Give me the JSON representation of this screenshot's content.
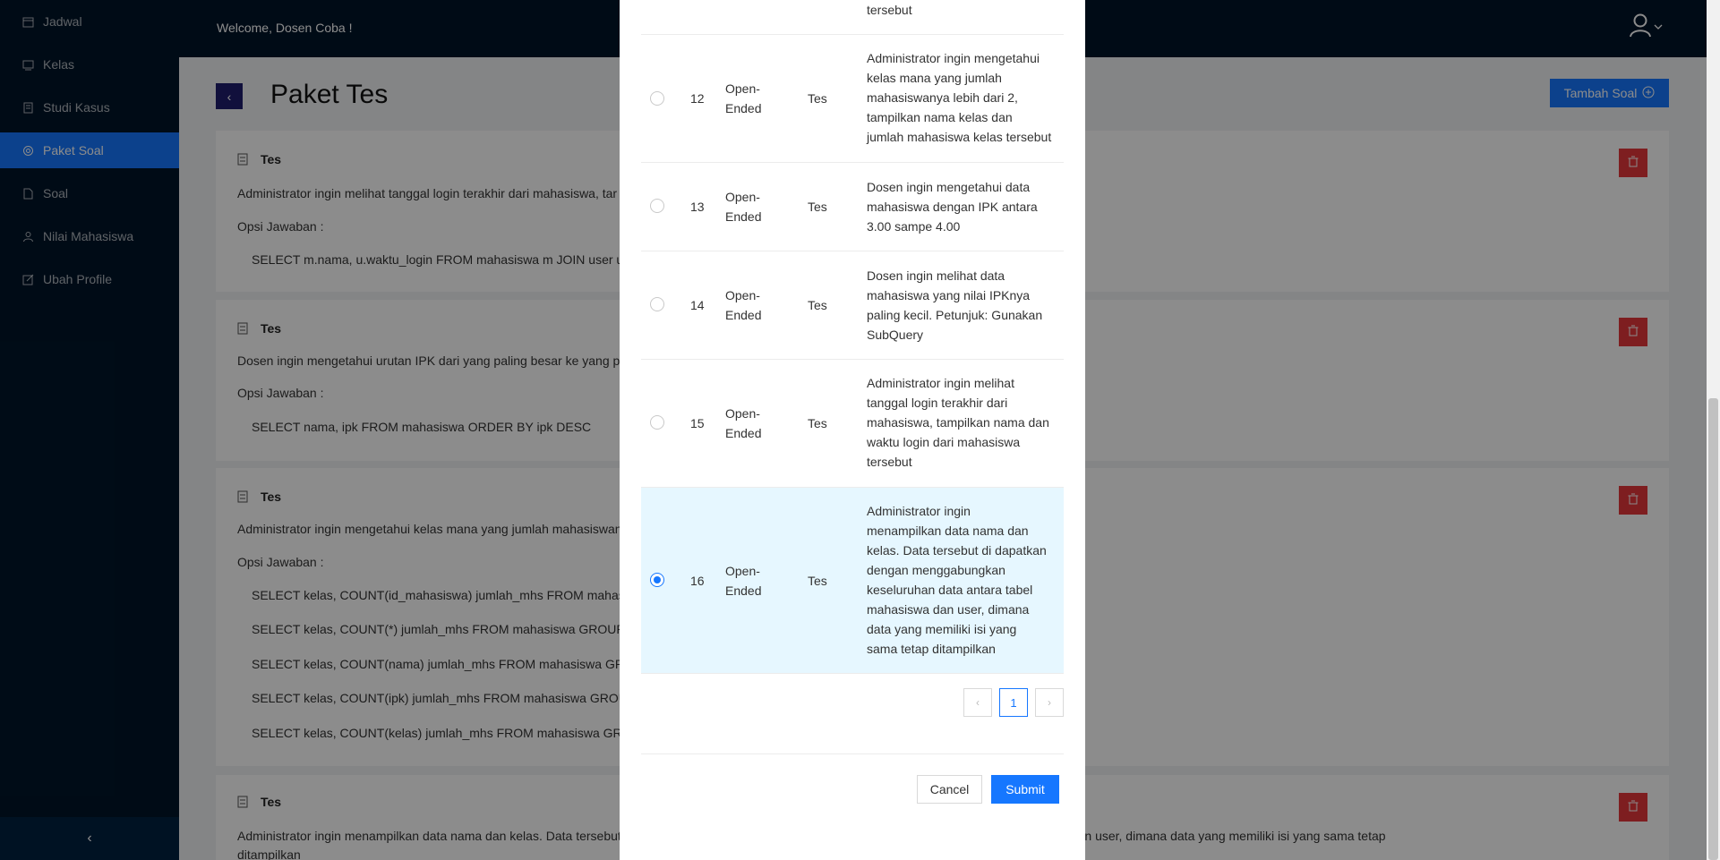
{
  "sidebar": {
    "items": [
      {
        "label": "Jadwal",
        "icon": "calendar-icon"
      },
      {
        "label": "Kelas",
        "icon": "classroom-icon"
      },
      {
        "label": "Studi Kasus",
        "icon": "list-icon"
      },
      {
        "label": "Paket Soal",
        "icon": "package-icon"
      },
      {
        "label": "Soal",
        "icon": "file-icon"
      },
      {
        "label": "Nilai Mahasiswa",
        "icon": "user-icon"
      },
      {
        "label": "Ubah Profile",
        "icon": "edit-icon"
      }
    ],
    "active": "Paket Soal",
    "collapse": "‹"
  },
  "header": {
    "welcome": "Welcome, Dosen Coba !",
    "user_icon": "user-icon",
    "chevron": "⌄"
  },
  "page": {
    "title": "Paket Tes",
    "add_button": "Tambah Soal",
    "back": "‹"
  },
  "cards": [
    {
      "title": "Tes",
      "question": "Administrator ingin melihat tanggal login terakhir dari mahasiswa, tar",
      "options_label": "Opsi Jawaban :",
      "options": [
        "SELECT m.nama, u.waktu_login FROM mahasiswa m JOIN user u ON"
      ]
    },
    {
      "title": "Tes",
      "question": "Dosen ingin mengetahui urutan IPK dari yang paling besar ke yang pa",
      "options_label": "Opsi Jawaban :",
      "options": [
        "SELECT nama, ipk FROM mahasiswa ORDER BY ipk DESC"
      ]
    },
    {
      "title": "Tes",
      "question": "Administrator ingin mengetahui kelas mana yang jumlah mahasiswan",
      "options_label": "Opsi Jawaban :",
      "options": [
        "SELECT kelas, COUNT(id_mahasiswa) jumlah_mhs FROM mahasiswa",
        "SELECT kelas, COUNT(*) jumlah_mhs FROM mahasiswa GROUP BY k",
        "SELECT kelas, COUNT(nama) jumlah_mhs FROM mahasiswa GROUP",
        "SELECT kelas, COUNT(ipk) jumlah_mhs FROM mahasiswa GROUP B",
        "SELECT kelas, COUNT(kelas) jumlah_mhs FROM mahasiswa GROUP"
      ]
    },
    {
      "title": "Tes",
      "question": "Administrator ingin menampilkan data nama dan kelas. Data tersebut di dapatkan dengan menggabungkan keseluruhan data antara tabel mahasiswa dan user, dimana data yang memiliki isi yang sama tetap",
      "question_cont": "ditampilkan"
    }
  ],
  "modal": {
    "top_fragment": "tersebut",
    "rows": [
      {
        "no": "12",
        "type": [
          "Open-",
          "Ended"
        ],
        "paket": "Tes",
        "desc": [
          "Administrator ingin mengetahui",
          "kelas mana yang jumlah",
          "mahasiswanya lebih dari 2,",
          "tampilkan nama kelas dan",
          "jumlah mahasiswa kelas tersebut"
        ],
        "selected": false
      },
      {
        "no": "13",
        "type": [
          "Open-",
          "Ended"
        ],
        "paket": "Tes",
        "desc": [
          "Dosen ingin mengetahui data",
          "mahasiswa dengan IPK antara",
          "3.00 sampe 4.00"
        ],
        "selected": false
      },
      {
        "no": "14",
        "type": [
          "Open-",
          "Ended"
        ],
        "paket": "Tes",
        "desc": [
          "Dosen ingin melihat data",
          "mahasiswa yang nilai IPKnya",
          "paling kecil. Petunjuk: Gunakan",
          "SubQuery"
        ],
        "selected": false
      },
      {
        "no": "15",
        "type": [
          "Open-",
          "Ended"
        ],
        "paket": "Tes",
        "desc": [
          "Administrator ingin melihat",
          "tanggal login terakhir dari",
          "mahasiswa, tampilkan nama dan",
          "waktu login dari mahasiswa",
          "tersebut"
        ],
        "selected": false
      },
      {
        "no": "16",
        "type": [
          "Open-",
          "Ended"
        ],
        "paket": "Tes",
        "desc": [
          "Administrator ingin",
          "menampilkan data nama dan",
          "kelas. Data tersebut di dapatkan",
          "dengan menggabungkan",
          "keseluruhan data antara tabel",
          "mahasiswa dan user, dimana",
          "data yang memiliki isi yang",
          "sama tetap ditampilkan"
        ],
        "selected": true
      }
    ],
    "pager": {
      "prev": "‹",
      "current": "1",
      "next": "›"
    },
    "cancel": "Cancel",
    "submit": "Submit"
  }
}
